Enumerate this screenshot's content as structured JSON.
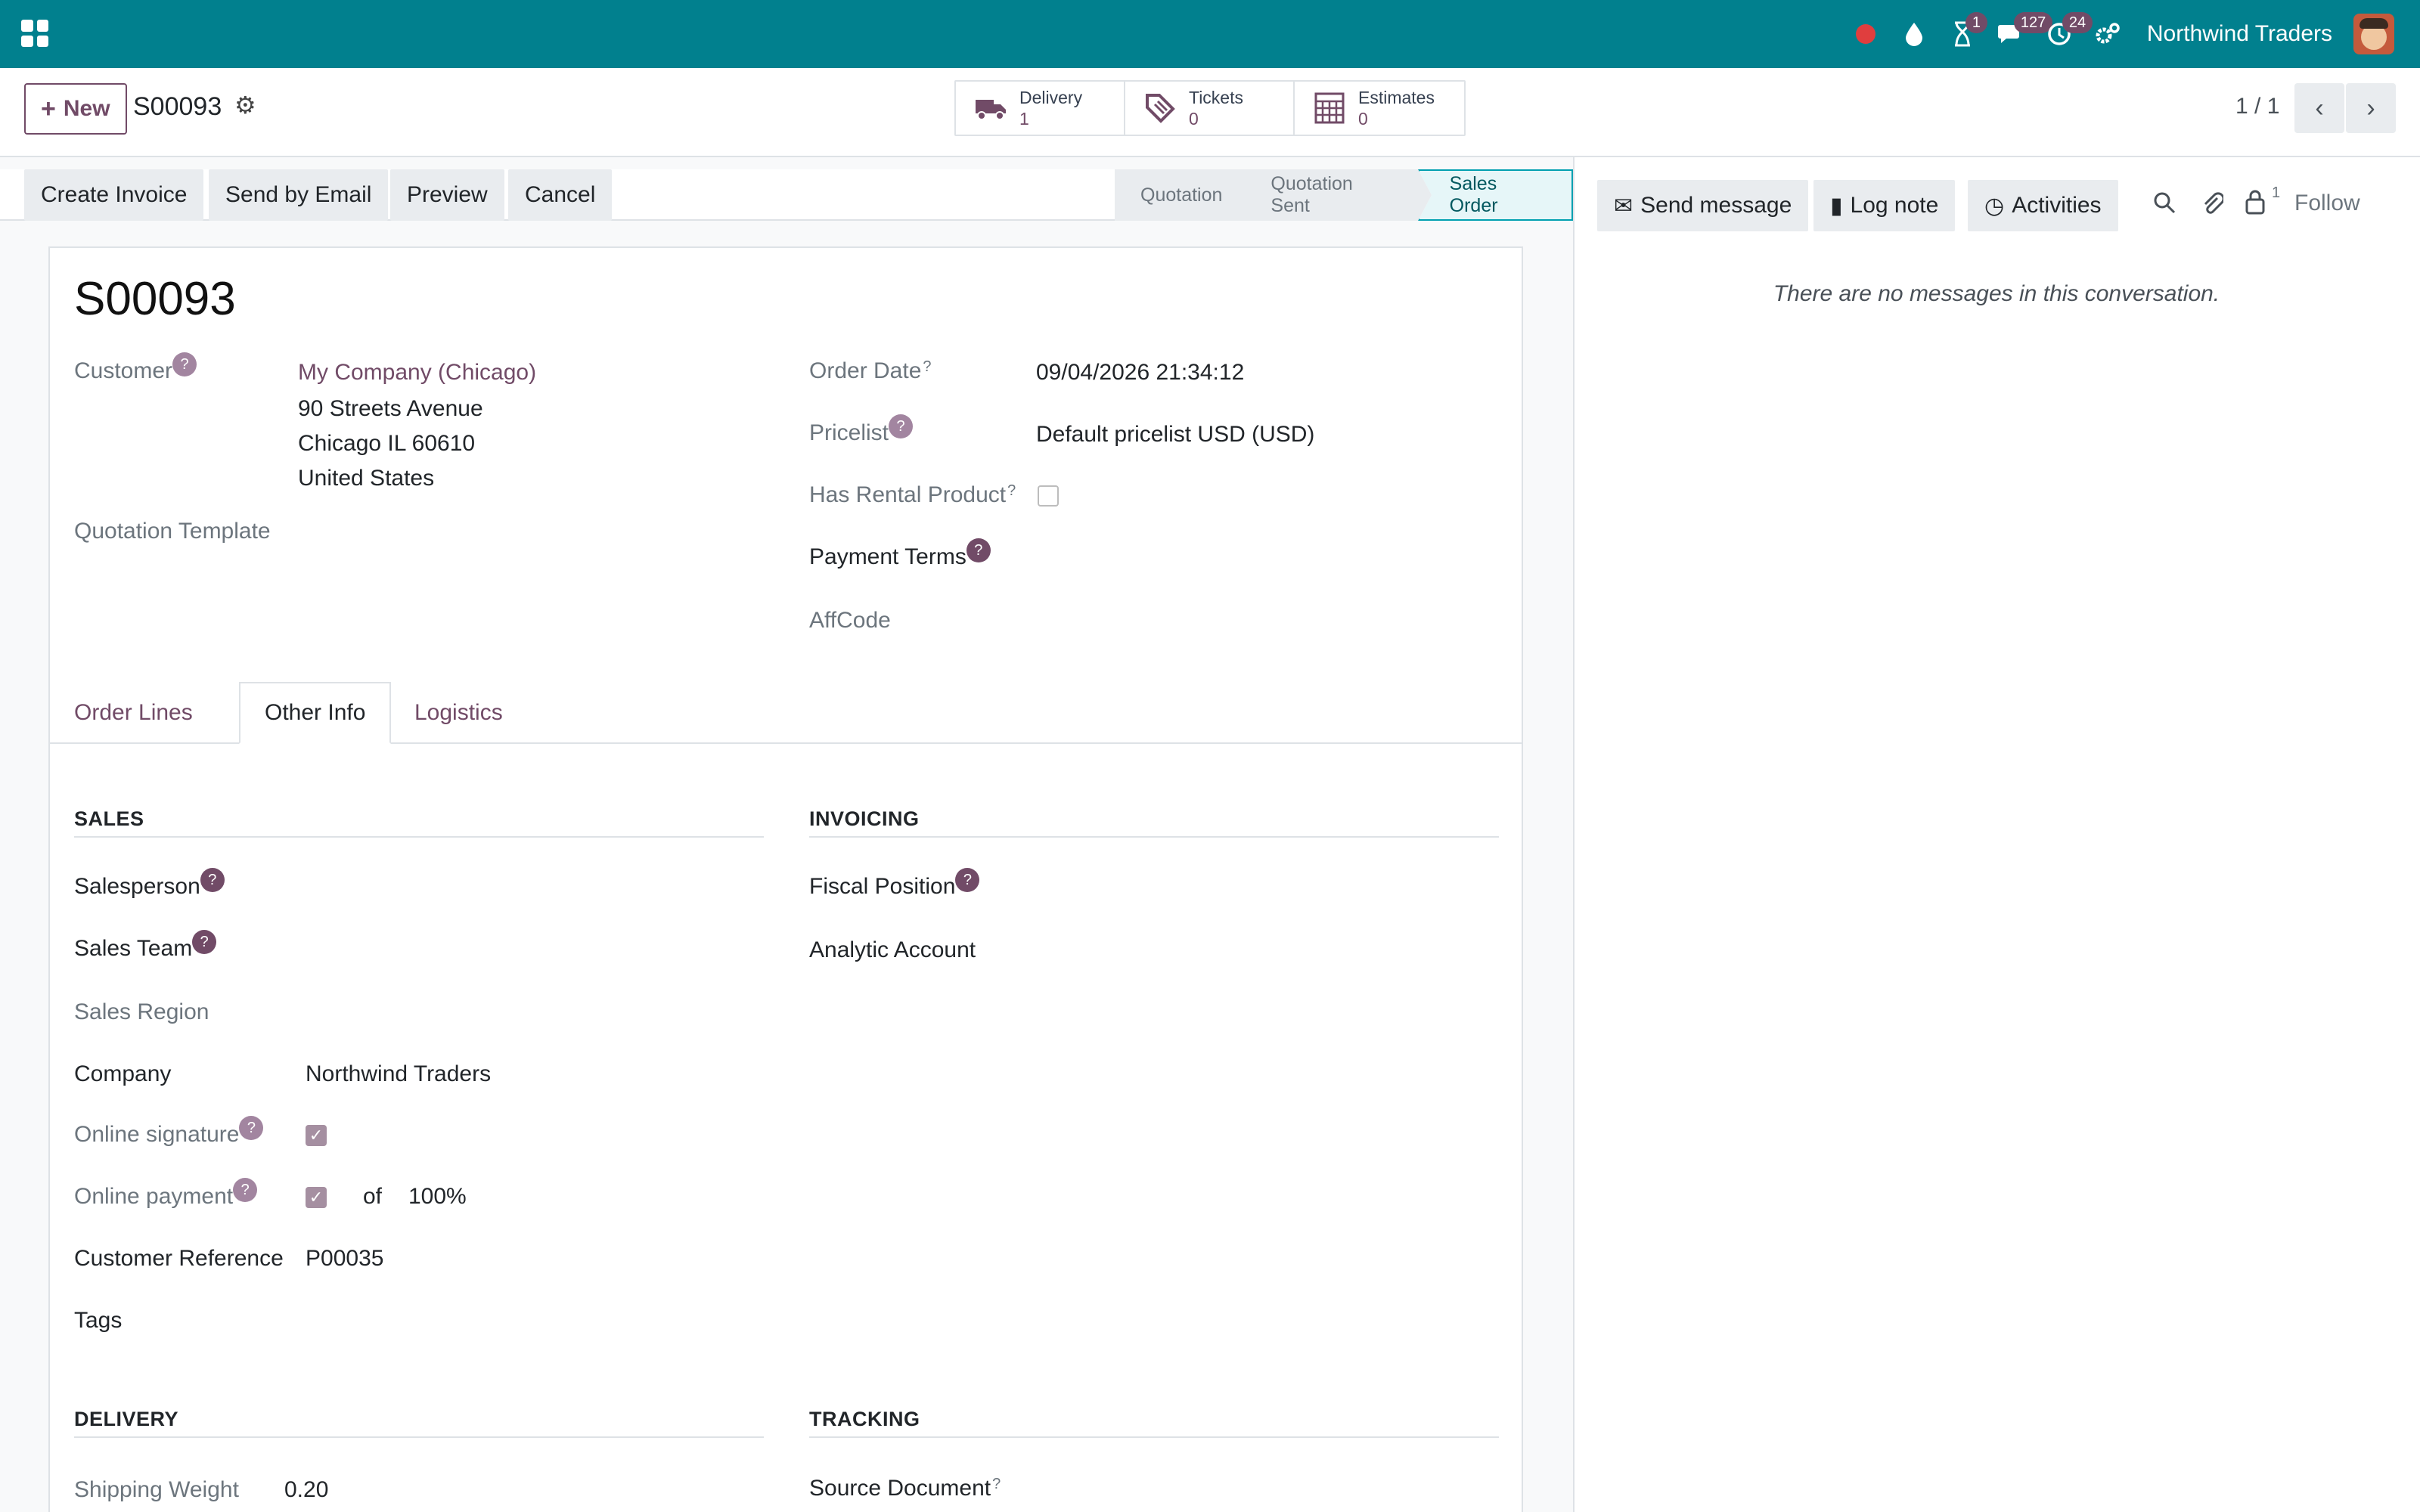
{
  "navbar": {
    "company": "Northwind Traders",
    "badges": {
      "activities": "1",
      "messages": "127",
      "timer": "24"
    }
  },
  "control_panel": {
    "new_label": "New",
    "record_name": "S00093",
    "smart_buttons": [
      {
        "label": "Delivery",
        "value": "1"
      },
      {
        "label": "Tickets",
        "value": "0"
      },
      {
        "label": "Estimates",
        "value": "0"
      }
    ],
    "pager": "1 / 1"
  },
  "status_bar": {
    "actions": [
      "Create Invoice",
      "Send by Email",
      "Preview",
      "Cancel"
    ],
    "stages": [
      "Quotation",
      "Quotation Sent",
      "Sales Order"
    ],
    "active_stage": "Sales Order"
  },
  "form": {
    "title": "S00093",
    "customer_label": "Customer",
    "customer_name": "My Company (Chicago)",
    "address": [
      "90 Streets Avenue",
      "Chicago IL 60610",
      "United States"
    ],
    "quotation_template_label": "Quotation Template",
    "order_date_label": "Order Date",
    "order_date": "09/04/2026 21:34:12",
    "pricelist_label": "Pricelist",
    "pricelist": "Default pricelist USD (USD)",
    "rental_label": "Has Rental Product",
    "payment_terms_label": "Payment Terms",
    "affcode_label": "AffCode",
    "tabs": [
      "Order Lines",
      "Other Info",
      "Logistics"
    ],
    "active_tab": "Other Info",
    "sales": {
      "title": "SALES",
      "salesperson_label": "Salesperson",
      "sales_team_label": "Sales Team",
      "sales_region_label": "Sales Region",
      "company_label": "Company",
      "company": "Northwind Traders",
      "online_signature_label": "Online signature",
      "online_payment_label": "Online payment",
      "of_label": "of",
      "payment_percent": "100%",
      "customer_reference_label": "Customer Reference",
      "customer_reference": "P00035",
      "tags_label": "Tags"
    },
    "invoicing": {
      "title": "INVOICING",
      "fiscal_position_label": "Fiscal Position",
      "analytic_account_label": "Analytic Account"
    },
    "delivery": {
      "title": "DELIVERY",
      "shipping_weight_label": "Shipping Weight",
      "shipping_weight": "0.20"
    },
    "tracking": {
      "title": "TRACKING",
      "source_document_label": "Source Document"
    }
  },
  "chatter": {
    "send_message": "Send message",
    "log_note": "Log note",
    "activities": "Activities",
    "followers_count": "1",
    "follow": "Follow",
    "empty": "There are no messages in this conversation."
  },
  "colors": {
    "navbar": "#01808e",
    "accent": "#714b67",
    "active_stage": "#01a0b0"
  }
}
